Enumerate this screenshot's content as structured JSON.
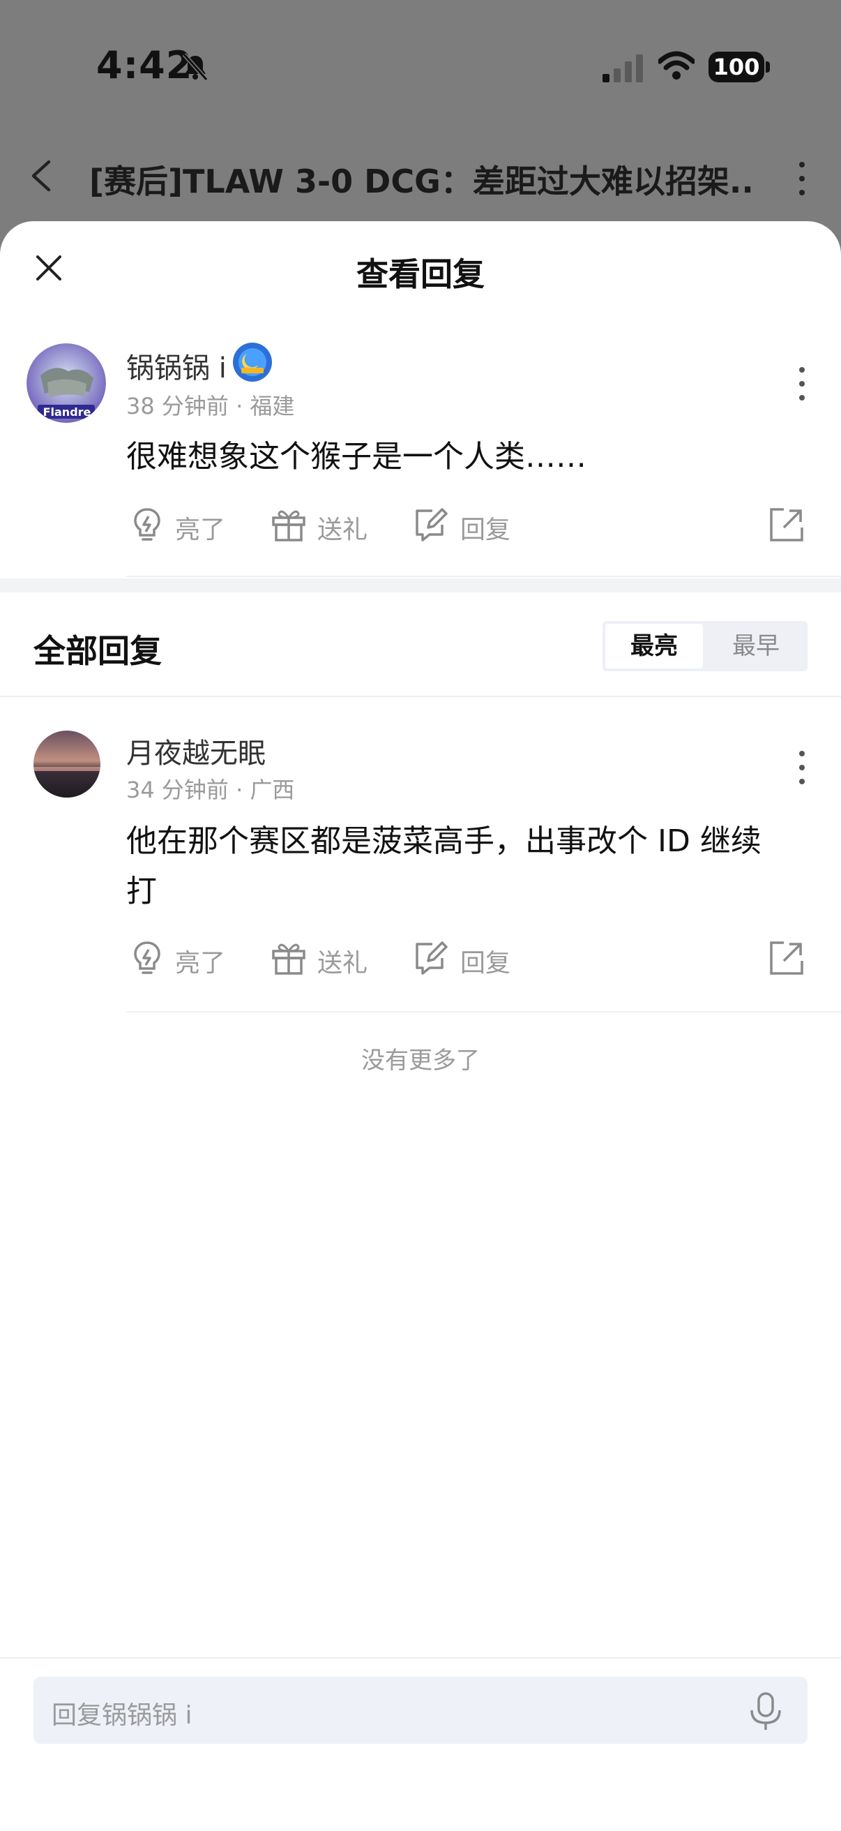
{
  "status_bar": {
    "time": "4:42",
    "battery": "100"
  },
  "nav": {
    "title": "[赛后]TLAW 3-0 DCG：差距过大难以招架..."
  },
  "sheet": {
    "title": "查看回复"
  },
  "original_comment": {
    "username": "锅锅锅 i",
    "avatar_text": "Flandre",
    "time": "38 分钟前",
    "location": "福建",
    "content": "很难想象这个猴子是一个人类……"
  },
  "actions": {
    "like": "亮了",
    "gift": "送礼",
    "reply": "回复"
  },
  "replies_section": {
    "title": "全部回复",
    "sort_options": [
      "最亮",
      "最早"
    ],
    "sort_selected": "最亮"
  },
  "replies": [
    {
      "username": "月夜越无眠",
      "time": "34 分钟前",
      "location": "广西",
      "content_line1": "他在那个赛区都是菠菜高手，出事改个 ID 继续",
      "content_line2": "打"
    }
  ],
  "no_more": "没有更多了",
  "input": {
    "placeholder": "回复锅锅锅 i"
  },
  "colors": {
    "accent_bg": "#eef0f6",
    "text_secondary": "#9a9a9a",
    "overlay": "#7d7d7d"
  }
}
